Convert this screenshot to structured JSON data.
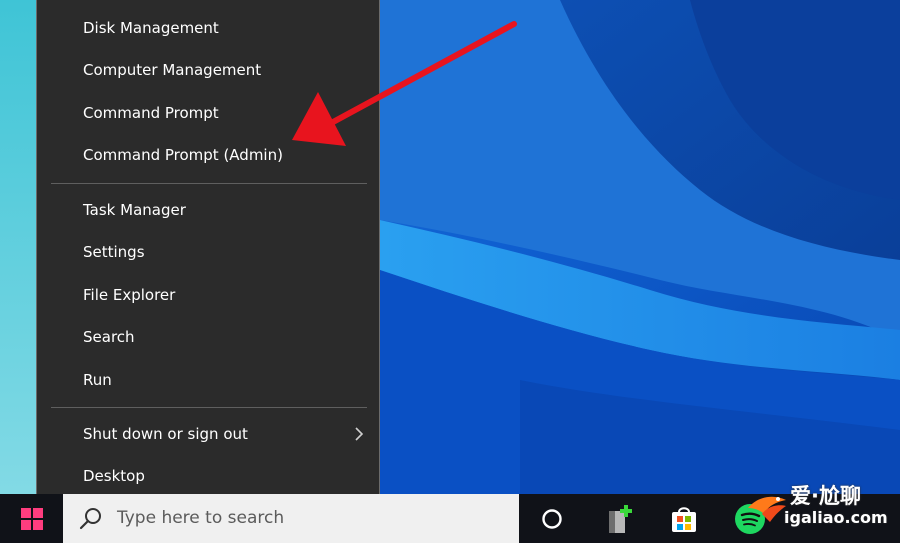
{
  "menu": {
    "items": [
      {
        "label": "Disk Management"
      },
      {
        "label": "Computer Management"
      },
      {
        "label": "Command Prompt"
      },
      {
        "label": "Command Prompt (Admin)"
      },
      {
        "label": "Task Manager"
      },
      {
        "label": "Settings"
      },
      {
        "label": "File Explorer"
      },
      {
        "label": "Search"
      },
      {
        "label": "Run"
      },
      {
        "label": "Shut down or sign out"
      },
      {
        "label": "Desktop"
      }
    ]
  },
  "taskbar": {
    "search_placeholder": "Type here to search",
    "icons": [
      "windows-logo-icon",
      "search-icon",
      "cortana-icon",
      "app-icon",
      "store-icon",
      "spotify-icon"
    ]
  },
  "watermark": {
    "text_cn": "爱·尬聊",
    "text_url": "igaliao.com"
  },
  "colors": {
    "menu_bg": "#2b2b2b",
    "taskbar_bg": "#101218",
    "arrow": "#e8141e",
    "wallpaper_blue": "#0a55c7",
    "start_icon": "#ff3d7f"
  }
}
